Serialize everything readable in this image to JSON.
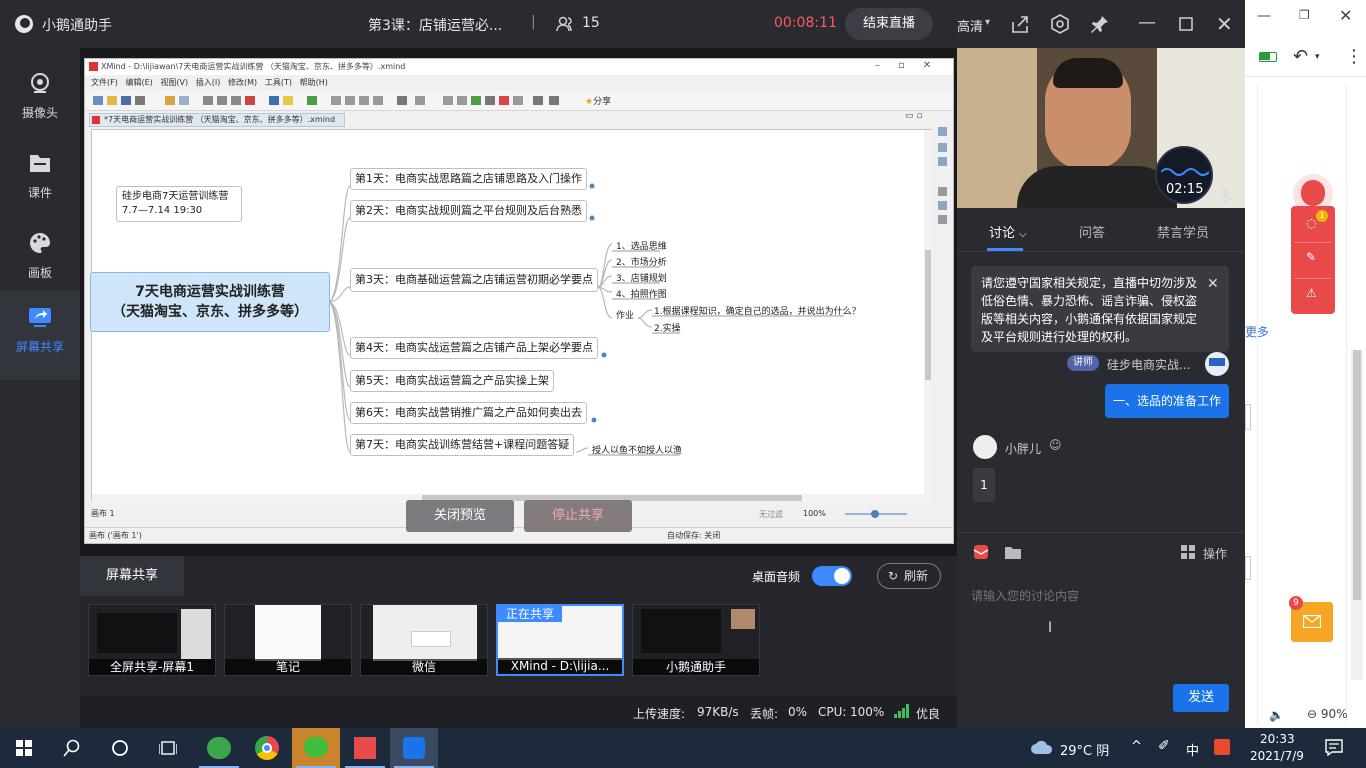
{
  "app": {
    "title": "小鹅通助手",
    "lesson_title": "第3课：店铺运营必...",
    "viewer_count": "15",
    "elapsed_time": "00:08:11",
    "end_live_label": "结束直播",
    "quality_label": "高清"
  },
  "sidebar": {
    "items": [
      {
        "label": "摄像头"
      },
      {
        "label": "课件"
      },
      {
        "label": "画板"
      },
      {
        "label": "屏幕共享"
      }
    ]
  },
  "xmind": {
    "window_title": "XMind - D:\\lijiawan\\7天电商运营实战训练营 （天猫淘宝、京东、拼多多等）.xmind",
    "menu": [
      "文件(F)",
      "编辑(E)",
      "视图(V)",
      "插入(I)",
      "修改(M)",
      "工具(T)",
      "帮助(H)"
    ],
    "share_label": "分享",
    "tab_label": "*7天电商运营实战训练营 （天猫淘宝、京东、拼多多等）.xmind",
    "central_topic": [
      "7天电商运营实战训练营",
      "（天猫淘宝、京东、拼多多等）"
    ],
    "floating_topic": [
      "硅步电商7天运营训练营",
      "7.7—7.14 19:30"
    ],
    "days": [
      "第1天：电商实战思路篇之店铺思路及入门操作",
      "第2天：电商实战规则篇之平台规则及后台熟悉",
      "第3天：电商基础运营篇之店铺运营初期必学要点",
      "第4天：电商实战运营篇之店铺产品上架必学要点",
      "第5天：电商实战运营篇之产品实操上架",
      "第6天：电商实战营销推广篇之产品如何卖出去",
      "第7天：电商实战训练营结营+课程问题答疑"
    ],
    "day3_children": [
      "1、选品思维",
      "2、市场分析",
      "3、店铺规划",
      "4、拍照作图"
    ],
    "homework_label": "作业",
    "homework_items": [
      "1.根据课程知识，确定自己的选品，并说出为什么？",
      "2.实操"
    ],
    "day7_child": "授人以鱼不如授人以渔",
    "sheet_label": "画布 1",
    "status_sheet": "画布 ('画布 1')",
    "autosave": "自动保存: 关闭",
    "unsaved": "无过滤",
    "zoom": "100%"
  },
  "overlay": {
    "close_preview": "关闭预览",
    "stop_share": "停止共享"
  },
  "share_panel": {
    "tab_label": "屏幕共享",
    "desktop_audio_label": "桌面音频",
    "refresh_label": "刷新",
    "sharing_badge": "正在共享",
    "thumbs": [
      "全屏共享-屏幕1",
      "笔记",
      "微信",
      "XMind - D:\\lijia...",
      "小鹅通助手"
    ]
  },
  "status": {
    "upload_label": "上传速度:",
    "upload_value": "97KB/s",
    "drop_label": "丢帧:",
    "drop_value": "0%",
    "cpu_label": "CPU:",
    "cpu_value": "100%",
    "quality": "优良"
  },
  "chat": {
    "cam_timer": "02:15",
    "tabs": [
      "讨论",
      "问答",
      "禁言学员"
    ],
    "notice": "请您遵守国家相关规定，直播中切勿涉及低俗色情、暴力恐怖、谣言诈骗、侵权盗版等相关内容，小鹅通保有依据国家规定及平台规则进行处理的权利。",
    "lecturer_badge": "讲师",
    "lecturer_name": "硅步电商实战...",
    "lecturer_msg": "一、选品的准备工作",
    "user_name": "小胖儿",
    "user_msg": "1",
    "ops_label": "操作",
    "input_placeholder": "请输入您的讨论内容",
    "send_label": "发送"
  },
  "bgapp": {
    "more_label": "更多",
    "badge_left": "1",
    "mail_badge": "9",
    "zoom": "90%"
  },
  "taskbar": {
    "weather": "29°C 阴",
    "ime": "中",
    "time": "20:33",
    "date": "2021/7/9"
  },
  "colors": {
    "accent": "#3d8bff",
    "danger": "#e84a4a",
    "timer_red": "#ff5a5a",
    "send_blue": "#1a73e8"
  }
}
